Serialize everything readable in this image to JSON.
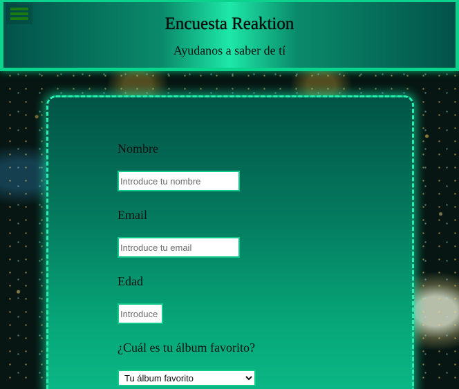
{
  "header": {
    "title": "Encuesta Reaktion",
    "subtitle": "Ayudanos a saber de tí",
    "menu_icon": "hamburger-menu-icon"
  },
  "form": {
    "nombre": {
      "label": "Nombre",
      "placeholder": "Introduce tu nombre",
      "value": ""
    },
    "email": {
      "label": "Email",
      "placeholder": "Introduce tu email",
      "value": ""
    },
    "edad": {
      "label": "Edad",
      "placeholder": "Introduce tu edad",
      "value": ""
    },
    "album": {
      "label": "¿Cuál es tu álbum favorito?",
      "selected": "Tu álbum favorito"
    }
  },
  "colors": {
    "accent": "#0bd28c",
    "card_border": "#26f0b0",
    "menu_bars": "#1b7a10"
  }
}
